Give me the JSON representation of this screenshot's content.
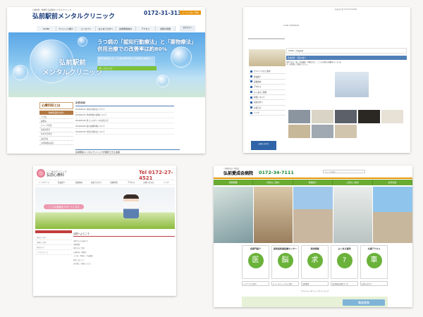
{
  "site1": {
    "logo_sub": "心療内科・精神科 弘前駅前メンタルクリニック",
    "logo": "弘前駅前メンタルクリニック",
    "tel": "0172-31-3133",
    "mail_btn": "メールでのご予約",
    "side_btn": "初診の方へ",
    "nav": [
      "HOME",
      "クリニック紹介",
      "コンセプト",
      "はじめての方へ",
      "診療時間案内",
      "アクセス",
      "当院の特徴"
    ],
    "hero_line1": "うつ病の「認知行動療法」と「薬物療法」",
    "hero_line2": "併用治療での改善率は約80%",
    "hero_clinic_1": "弘前駅前",
    "hero_clinic_2": "メンタルクリニック",
    "hero_note": "認知行動療法とは、うつ病の再発予防にも効果的な治療法です。",
    "hero_btn": "詳しくはこちら",
    "left_head": "心療内科とは",
    "left_sub": "精神科医師の紹介",
    "left_items": [
      "うつ病",
      "躁鬱病",
      "パニック障害",
      "強迫性障害",
      "社交不安障害",
      "適応障害",
      "自律神経失調症"
    ],
    "news_title": "新着情報",
    "news": [
      "2016/06/14  当院の休診日について",
      "2016/05/21  年末年始の診療について",
      "2016/05/10  新しいスタッフのお知らせ",
      "2016/04/02  春の診療時間について",
      "2016/03/15  当院の休診日について"
    ],
    "recommend": "弘前駅前メンタルクリニックが推奨できる治療"
  },
  "site2": {
    "top_info": "弘前市大町 0172-00-0000",
    "hdr_text": "CLINIC HOMEPAGE",
    "bread": "HOME > 院長挨拶",
    "greet": "院長挨拶・当院の紹介",
    "para": "当院ではうつ病・不安障害・不眠症など、こころの病気の治療を行っています。お気軽にご相談ください。",
    "menu": [
      "クリニックのご案内",
      "院長紹介",
      "診療案内",
      "アクセス",
      "よくあるご質問",
      "料金について",
      "初診の方へ",
      "お知らせ",
      "リンク"
    ],
    "contact": "お問い合わせ"
  },
  "site3": {
    "logo_small": "こころのクリニック",
    "logo_big": "弘前心療科",
    "tel": "Tel 0172-27-4521",
    "nav": [
      "トップページ",
      "院長紹介",
      "診療案内",
      "初めての方へ",
      "診療時間",
      "アクセス",
      "お問い合わせ",
      "リンク"
    ],
    "hero_text": "こころの健康をサポートします",
    "welcome": "当院へようこそ",
    "lines": [
      "当院からのお知らせ",
      "診療時間",
      "休診日のご案内",
      "心療内科・精神科",
      "うつ病・不眠症・不安障害",
      "院長ごあいさつ",
      "お気軽にご相談ください"
    ],
    "left_items": [
      "院長のご紹介",
      "診療のご案内",
      "初診の方へ",
      "アクセスマップ"
    ]
  },
  "site4": {
    "logo_sub": "一般財団法人 愛成会",
    "logo": "弘前愛成会病院",
    "tel": "0172-34-7111",
    "search": "サイト内検索",
    "nav": [
      "病院概要",
      "外来のご案内",
      "病棟紹介",
      "入院のご案内",
      "在宅支援"
    ],
    "cards": [
      {
        "t": "各部門紹介",
        "icon": "医"
      },
      {
        "t": "認知症疾患医療センター",
        "icon": "脳"
      },
      {
        "t": "採用情報",
        "icon": "求"
      },
      {
        "t": "よくある質問",
        "icon": "?"
      },
      {
        "t": "交通アクセス",
        "icon": "車"
      }
    ],
    "row2": [
      "デイケアのご案内",
      "ストレスチェックのご案内",
      "訪問看護",
      "弘前愛成会病院ブログ",
      "お問い合わせ"
    ],
    "fnav": "プライバシーポリシー | サイトマップ",
    "recruit_btn": "職員募集"
  }
}
